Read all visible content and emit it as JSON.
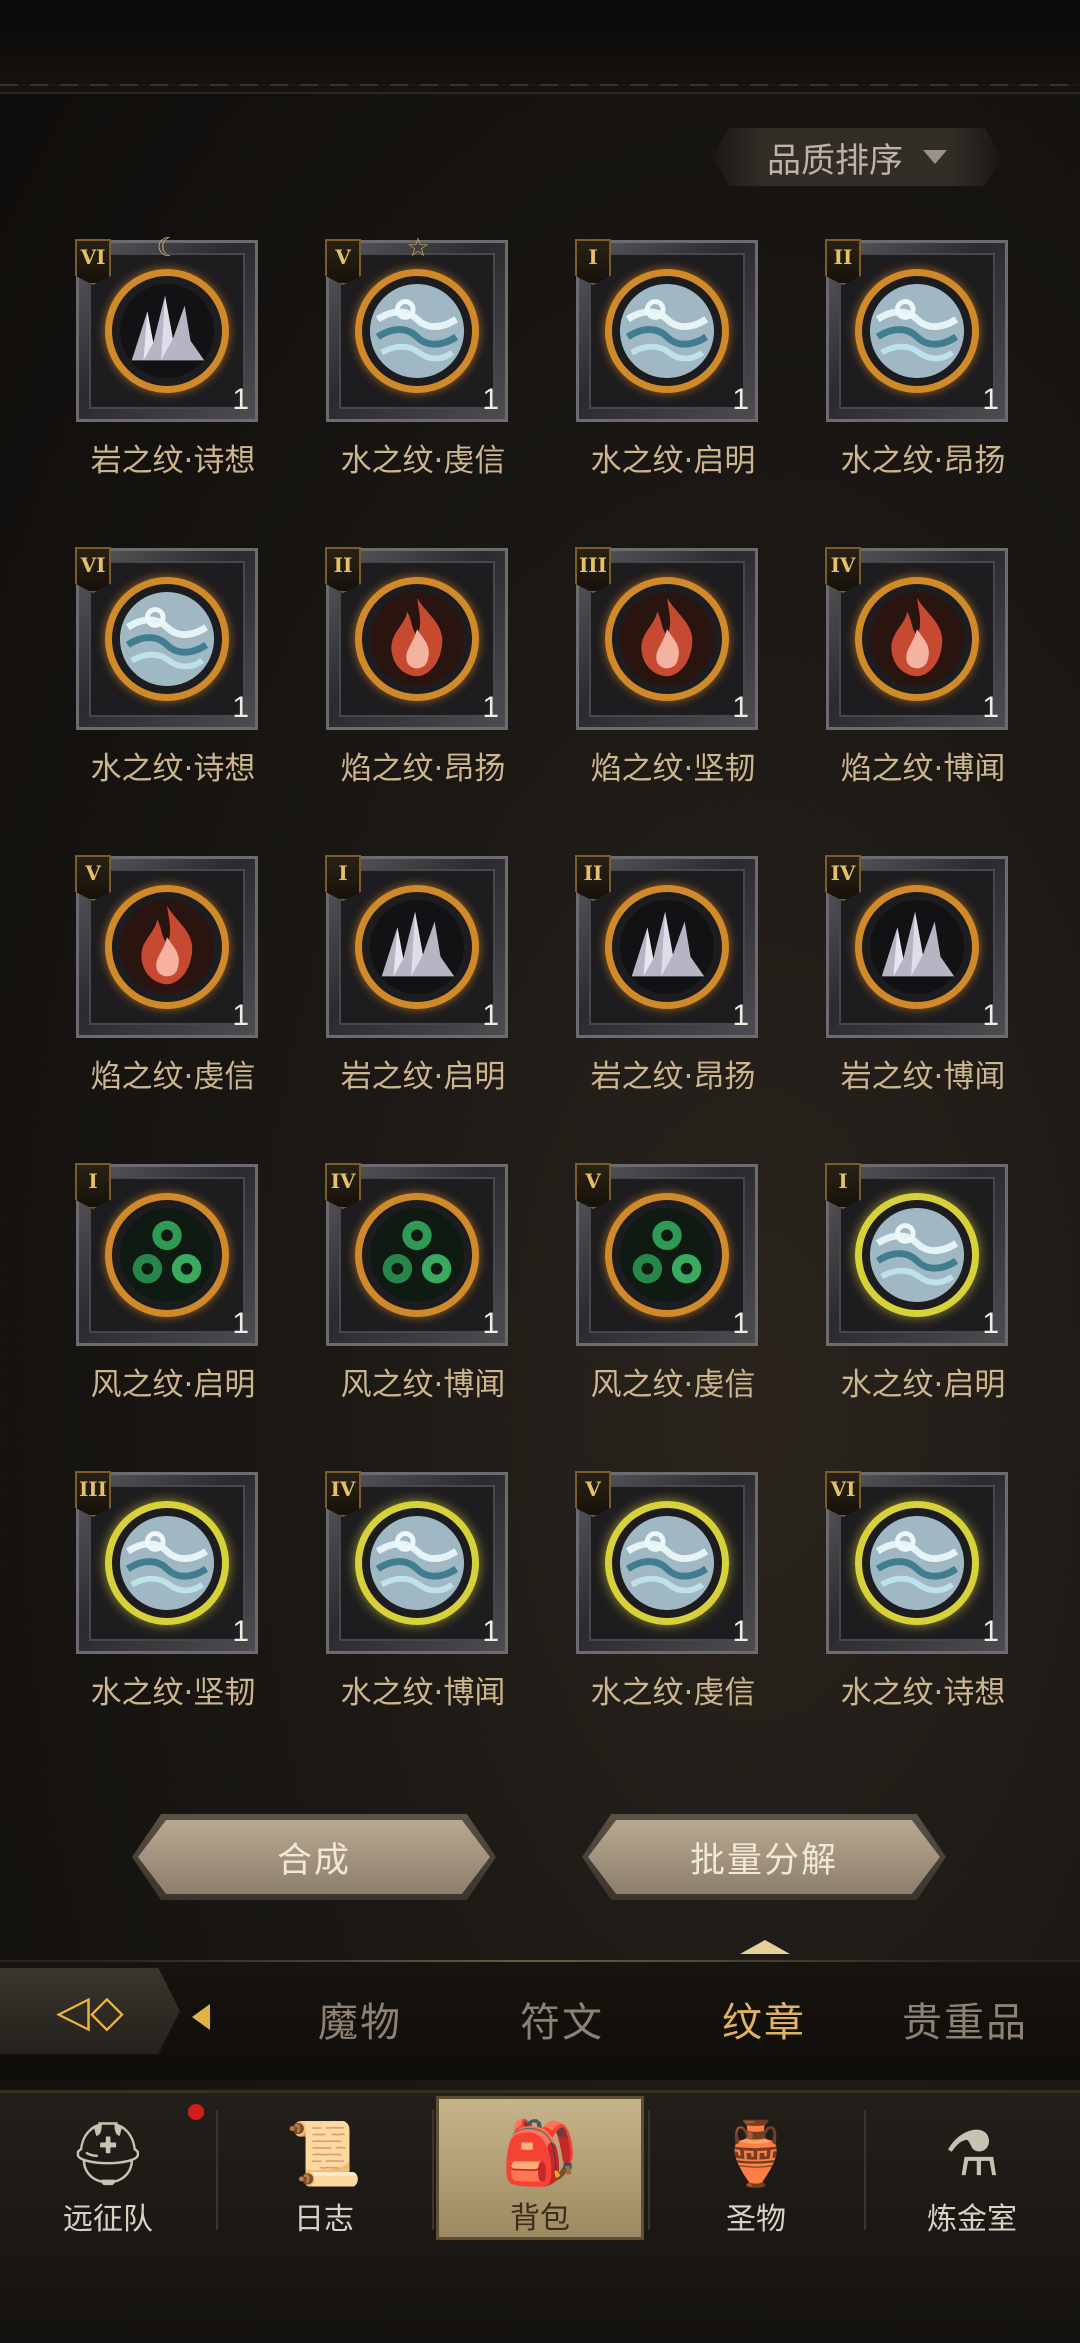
{
  "sort": {
    "label": "品质排序"
  },
  "items": [
    {
      "rank": "VI",
      "badge": "☾",
      "type": "rock",
      "ring": "orange",
      "count": "1",
      "name": "岩之纹·诗想"
    },
    {
      "rank": "V",
      "badge": "☆",
      "type": "water",
      "ring": "orange",
      "count": "1",
      "name": "水之纹·虔信"
    },
    {
      "rank": "I",
      "badge": "",
      "type": "water",
      "ring": "orange",
      "count": "1",
      "name": "水之纹·启明"
    },
    {
      "rank": "II",
      "badge": "",
      "type": "water",
      "ring": "orange",
      "count": "1",
      "name": "水之纹·昂扬"
    },
    {
      "rank": "VI",
      "badge": "",
      "type": "water",
      "ring": "orange",
      "count": "1",
      "name": "水之纹·诗想"
    },
    {
      "rank": "II",
      "badge": "",
      "type": "fire",
      "ring": "orange",
      "count": "1",
      "name": "焰之纹·昂扬"
    },
    {
      "rank": "III",
      "badge": "",
      "type": "fire",
      "ring": "orange",
      "count": "1",
      "name": "焰之纹·坚韧"
    },
    {
      "rank": "IV",
      "badge": "",
      "type": "fire",
      "ring": "orange",
      "count": "1",
      "name": "焰之纹·博闻"
    },
    {
      "rank": "V",
      "badge": "",
      "type": "fire",
      "ring": "orange",
      "count": "1",
      "name": "焰之纹·虔信"
    },
    {
      "rank": "I",
      "badge": "",
      "type": "rock",
      "ring": "orange",
      "count": "1",
      "name": "岩之纹·启明"
    },
    {
      "rank": "II",
      "badge": "",
      "type": "rock",
      "ring": "orange",
      "count": "1",
      "name": "岩之纹·昂扬"
    },
    {
      "rank": "IV",
      "badge": "",
      "type": "rock",
      "ring": "orange",
      "count": "1",
      "name": "岩之纹·博闻"
    },
    {
      "rank": "I",
      "badge": "",
      "type": "wind",
      "ring": "orange",
      "count": "1",
      "name": "风之纹·启明"
    },
    {
      "rank": "IV",
      "badge": "",
      "type": "wind",
      "ring": "orange",
      "count": "1",
      "name": "风之纹·博闻"
    },
    {
      "rank": "V",
      "badge": "",
      "type": "wind",
      "ring": "orange",
      "count": "1",
      "name": "风之纹·虔信"
    },
    {
      "rank": "I",
      "badge": "",
      "type": "water",
      "ring": "yellow",
      "count": "1",
      "name": "水之纹·启明"
    },
    {
      "rank": "III",
      "badge": "",
      "type": "water",
      "ring": "yellow",
      "count": "1",
      "name": "水之纹·坚韧"
    },
    {
      "rank": "IV",
      "badge": "",
      "type": "water",
      "ring": "yellow",
      "count": "1",
      "name": "水之纹·博闻"
    },
    {
      "rank": "V",
      "badge": "",
      "type": "water",
      "ring": "yellow",
      "count": "1",
      "name": "水之纹·虔信"
    },
    {
      "rank": "VI",
      "badge": "",
      "type": "water",
      "ring": "yellow",
      "count": "1",
      "name": "水之纹·诗想"
    }
  ],
  "actions": {
    "synthesize": "合成",
    "batch_decompose": "批量分解"
  },
  "tabs": [
    {
      "label": "魔物",
      "active": false
    },
    {
      "label": "符文",
      "active": false
    },
    {
      "label": "纹章",
      "active": true
    },
    {
      "label": "贵重品",
      "active": false
    }
  ],
  "nav": [
    {
      "label": "远征队",
      "icon": "viking-helmet-icon",
      "glyph": "⛑",
      "active": false,
      "notify": true
    },
    {
      "label": "日志",
      "icon": "journal-scroll-icon",
      "glyph": "📜",
      "active": false,
      "notify": false
    },
    {
      "label": "背包",
      "icon": "backpack-icon",
      "glyph": "🎒",
      "active": true,
      "notify": false
    },
    {
      "label": "圣物",
      "icon": "relic-torch-icon",
      "glyph": "🏺",
      "active": false,
      "notify": false
    },
    {
      "label": "炼金室",
      "icon": "alchemy-icon",
      "glyph": "⚗",
      "active": false,
      "notify": false
    }
  ],
  "colors": {
    "accent": "#e1b262",
    "ring_orange": "#d18a2a",
    "ring_yellow": "#d8d23a",
    "notify": "#d21d1d"
  }
}
